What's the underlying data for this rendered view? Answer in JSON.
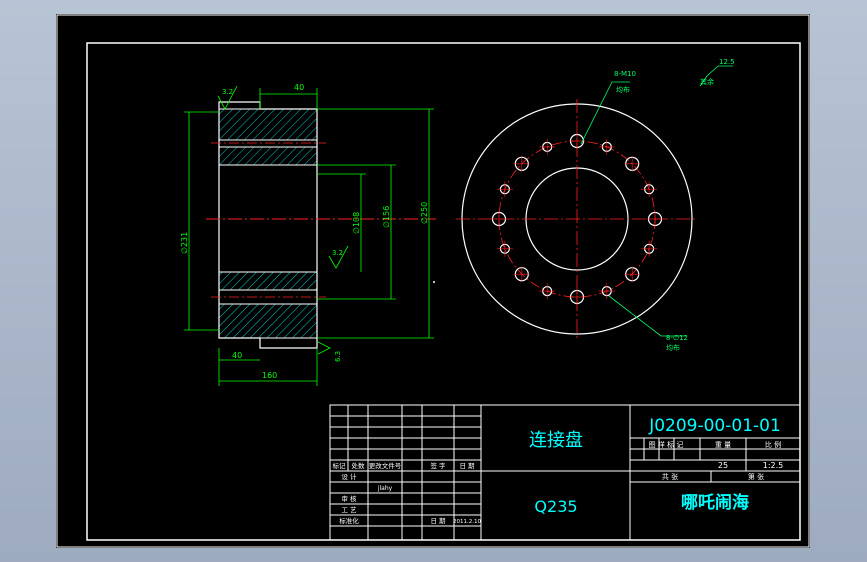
{
  "part_name": "连接盘",
  "material": "Q235",
  "drawing_number": "J0209-00-01-01",
  "scale": "1:2.5",
  "weight": "25",
  "author_name": "哪吒闹海",
  "labels": {
    "graph_mark": "图 样 标 记",
    "weight_label": "重 量",
    "scale_label": "比 例",
    "total_sheets": "共 张",
    "sheet_no": "第 张",
    "rev_headers": [
      "标记",
      "处数",
      "更改文件号",
      "签 字",
      "日 期"
    ],
    "design": "设 计",
    "check": "审 核",
    "process": "工 艺",
    "standard": "标准化",
    "date_label": "日 期",
    "designer": "jlahy",
    "date_value": "2011.2.10"
  },
  "section_view": {
    "dims": {
      "top_width": "40",
      "bottom_step": "40",
      "overall_len": "160",
      "outer_dia": "∅250",
      "inner_dia": "∅156",
      "bore": "∅108",
      "bolt_circle": "∅231"
    },
    "roughness": [
      "3.2",
      "3.2",
      "6.3"
    ]
  },
  "front_view": {
    "callout_top": "8-M10",
    "callout_top_sub": "均布",
    "callout_bottom": "8-∅12",
    "callout_bottom_sub": "均布",
    "roughness_note": "12.5",
    "roughness_note_sub": "其余"
  },
  "colors": {
    "outline": "#ffffff",
    "dim": "#00ff00",
    "center": "#ff2020",
    "hatch": "#00ffff",
    "callout": "#00ff66",
    "title_text": "#00ffff"
  }
}
